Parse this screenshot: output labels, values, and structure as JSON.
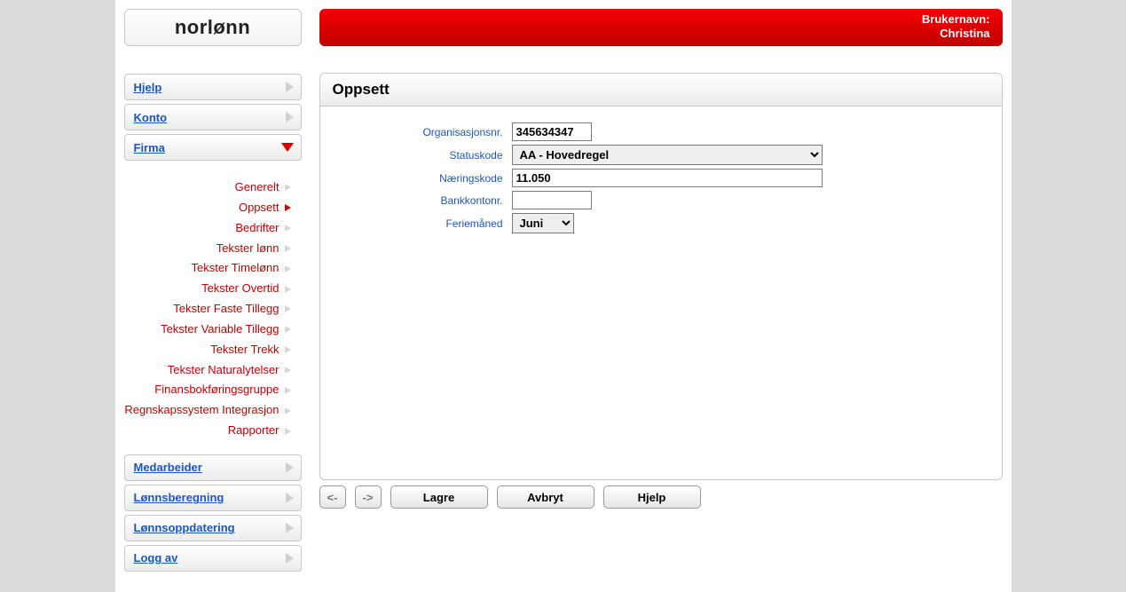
{
  "logo": "norlønn",
  "header": {
    "label": "Brukernavn:",
    "username": "Christina"
  },
  "nav": {
    "hjelp": "Hjelp",
    "konto": "Konto",
    "firma": "Firma",
    "medarbeider": "Medarbeider",
    "lonnsberegning": "Lønnsberegning",
    "lonnsoppdatering": "Lønnsoppdatering",
    "loggav": "Logg av"
  },
  "firmaSub": [
    "Generelt",
    "Oppsett",
    "Bedrifter",
    "Tekster lønn",
    "Tekster Timelønn",
    "Tekster Overtid",
    "Tekster Faste Tillegg",
    "Tekster Variable Tillegg",
    "Tekster Trekk",
    "Tekster Naturalytelser",
    "Finansbokføringsgruppe",
    "Regnskapssystem Integrasjon",
    "Rapporter"
  ],
  "firmaSubActive": "Oppsett",
  "panel": {
    "title": "Oppsett"
  },
  "form": {
    "orgnr": {
      "label": "Organisasjonsnr.",
      "value": "345634347"
    },
    "statuskode": {
      "label": "Statuskode",
      "value": "AA - Hovedregel"
    },
    "naering": {
      "label": "Næringskode",
      "value": "11.050"
    },
    "bankkonto": {
      "label": "Bankkontonr.",
      "value": ""
    },
    "feriemnd": {
      "label": "Feriemåned",
      "value": "Juni"
    }
  },
  "buttons": {
    "prev": "<-",
    "next": "->",
    "lagre": "Lagre",
    "avbryt": "Avbryt",
    "hjelp": "Hjelp"
  }
}
